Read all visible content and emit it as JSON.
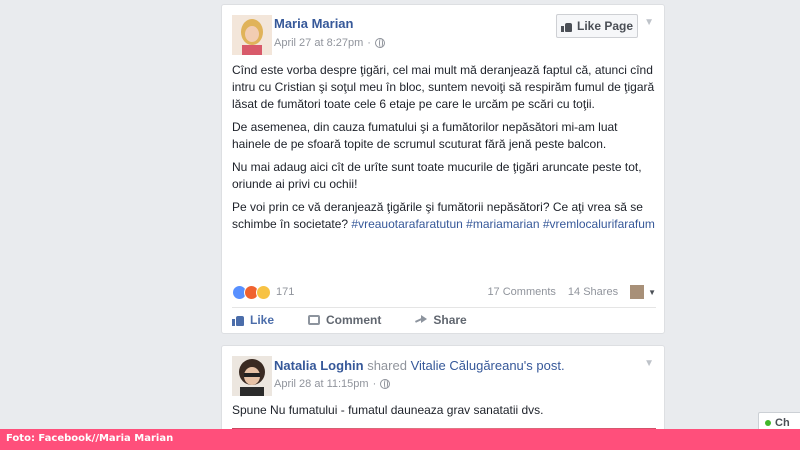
{
  "post1": {
    "author": "Maria Marian",
    "timestamp": "April 27 at 8:27pm",
    "separator": "·",
    "like_page_label": "Like Page",
    "paragraphs": [
      "Cînd este vorba despre ţigări, cel mai mult mă deranjează faptul că, atunci cînd intru cu Cristian şi soţul meu în bloc, suntem nevoiţi să respirăm fumul de ţigară lăsat de fumători toate cele 6 etaje pe care le urcăm pe scări cu toţii.",
      "De asemenea, din cauza fumatului şi a fumătorilor nepăsători mi-am luat hainele de pe sfoară topite de scrumul scuturat fără jenă peste balcon.",
      "Nu mai adaug aici cît de urîte sunt toate mucurile de ţigări aruncate peste tot, oriunde ai privi cu ochii!"
    ],
    "last_paragraph": "Pe voi prin ce vă deranjează ţigările şi fumătorii nepăsători? Ce aţi vrea să se schimbe în societate?",
    "hashtags": [
      "#vreauotarafaratutun",
      "#mariamarian",
      "#vremlocalurifarafum"
    ],
    "reaction_count": "171",
    "comments": "17 Comments",
    "shares": "14 Shares",
    "actions": {
      "like": "Like",
      "comment": "Comment",
      "share": "Share"
    }
  },
  "post2": {
    "author": "Natalia Loghin",
    "shared_text": "shared",
    "shared_from": "Vitalie Călugăreanu",
    "shared_suffix": "'s post.",
    "timestamp": "April 28 at 11:15pm",
    "separator": "·",
    "body": "Spune Nu fumatului - fumatul dauneaza grav sanatatii dvs."
  },
  "caption": "Foto: Facebook//Maria Marian",
  "chat": {
    "label": "Ch"
  },
  "colors": {
    "link": "#365899",
    "caption_bar": "#ff4f7b",
    "online": "#42b72a"
  },
  "icons": {
    "globe": "globe-icon",
    "chevron": "chevron-down-icon",
    "like": "thumbs-up-icon",
    "comment": "comment-icon",
    "share": "share-arrow-icon"
  }
}
